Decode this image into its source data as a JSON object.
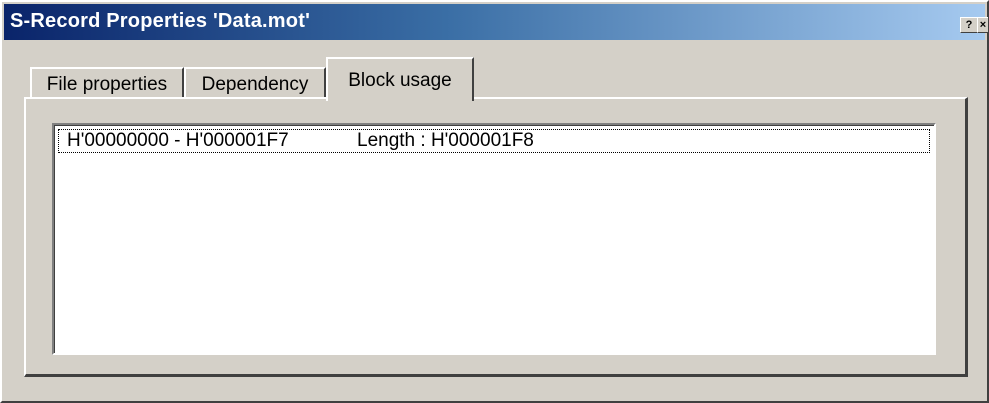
{
  "window": {
    "title": "S-Record Properties 'Data.mot'",
    "help_glyph": "?",
    "close_glyph": "×"
  },
  "tabs": [
    {
      "label": "File properties",
      "active": false
    },
    {
      "label": "Dependency",
      "active": false
    },
    {
      "label": "Block usage",
      "active": true
    }
  ],
  "block_usage": {
    "rows": [
      {
        "range": "H'00000000 - H'000001F7",
        "length": "Length : H'000001F8"
      }
    ]
  },
  "colors": {
    "titlebar_start": "#0a246a",
    "titlebar_end": "#a6caf0",
    "face": "#d4d0c8"
  }
}
